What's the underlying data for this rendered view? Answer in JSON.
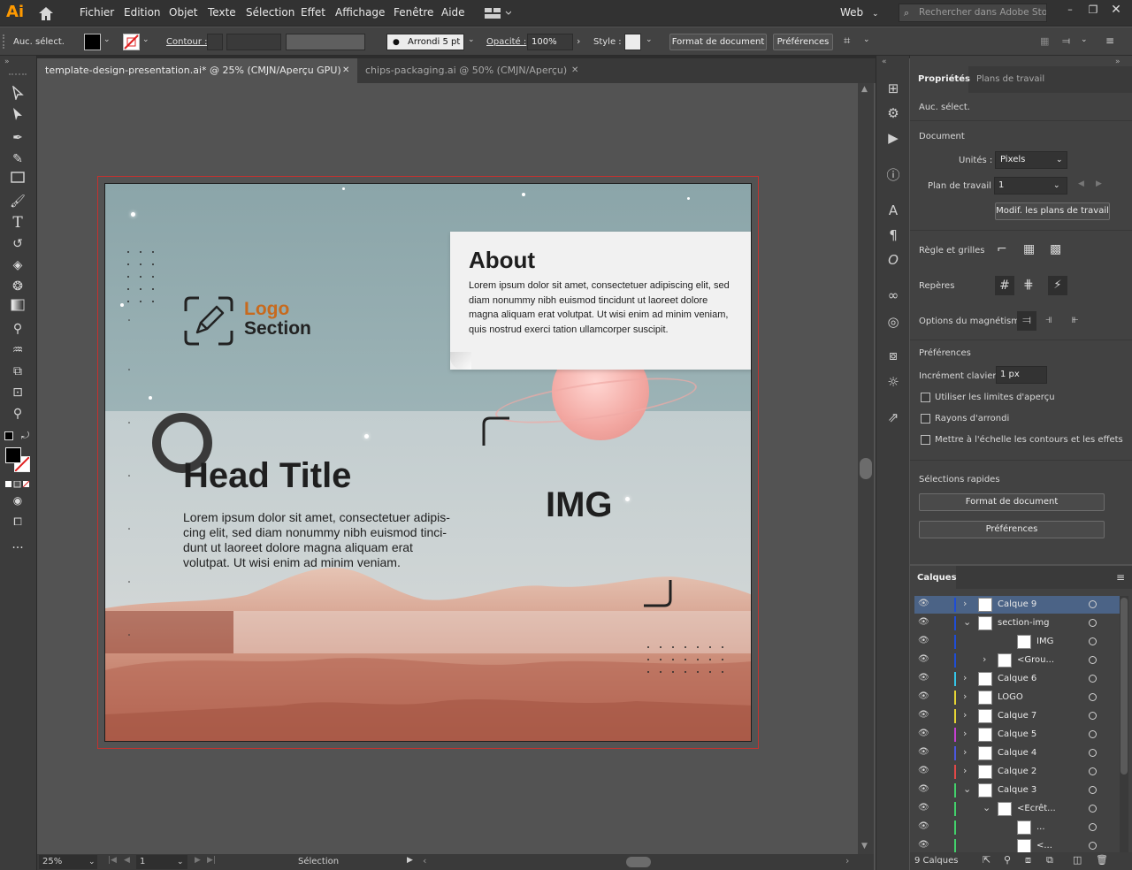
{
  "app": {
    "logo": "Ai",
    "menus": [
      "Fichier",
      "Edition",
      "Objet",
      "Texte",
      "Sélection",
      "Effet",
      "Affichage",
      "Fenêtre",
      "Aide"
    ],
    "workspace": "Web",
    "search_placeholder": "Rechercher dans Adobe Stock"
  },
  "control": {
    "selection": "Auc. sélect.",
    "stroke_label": "Contour :",
    "brush": "Arrondi 5 pt",
    "opacity_label": "Opacité :",
    "opacity": "100%",
    "style_label": "Style :",
    "doc_format": "Format de document",
    "prefs": "Préférences"
  },
  "tabs": [
    {
      "label": "template-design-presentation.ai* @ 25% (CMJN/Aperçu GPU)"
    },
    {
      "label": "chips-packaging.ai @ 50% (CMJN/Aperçu)"
    }
  ],
  "artboard": {
    "about_title": "About",
    "about_text": "Lorem ipsum dolor sit amet, consectetuer adipiscing elit, sed diam nonummy nibh euismod tincidunt ut laoreet dolore magna aliquam erat volutpat. Ut wisi enim ad minim veniam, quis nostrud exerci tation ullamcorper suscipit.",
    "logo_word": "Logo",
    "logo_section": "Section",
    "head_title": "Head Title",
    "head_text": "Lorem ipsum dolor sit amet, consectetuer adipis-cing elit, sed diam nonummy nibh euismod tinci-dunt ut laoreet dolore magna aliquam erat volutpat. Ut wisi enim ad minim veniam.",
    "img_label": "IMG",
    "colors": {
      "sky": "#8fa7ab",
      "mid": "#c6cfd1",
      "sand": "#c9836e",
      "about_box": "#f1f1f1",
      "logo_accent": "#c76a1e"
    }
  },
  "status": {
    "zoom": "25%",
    "artboard_num": "1",
    "tool": "Sélection"
  },
  "properties": {
    "tab_props": "Propriétés",
    "tab_boards": "Plans de travail",
    "no_selection": "Auc. sélect.",
    "document": "Document",
    "units_label": "Unités :",
    "units": "Pixels",
    "artboard_label": "Plan de travail :",
    "artboard_value": "1",
    "edit_boards": "Modif. les plans de travail",
    "rulers": "Règle et grilles",
    "guides": "Repères",
    "snap": "Options du magnétisme",
    "prefs_title": "Préférences",
    "keyboard_label": "Incrément clavier :",
    "keyboard_value": "1 px",
    "chk1": "Utiliser les limites d'aperçu",
    "chk2": "Rayons d'arrondi",
    "chk3": "Mettre à l'échelle les contours et les effets",
    "quick": "Sélections rapides",
    "qbtn1": "Format de document",
    "qbtn2": "Préférences"
  },
  "layers": {
    "title": "Calques",
    "count": "9 Calques",
    "rows": [
      {
        "name": "Calque 9",
        "color": "#1f4dd6",
        "indent": 0,
        "arrow": "›",
        "selected": true
      },
      {
        "name": "section-img",
        "color": "#1f4dd6",
        "indent": 0,
        "arrow": "⌄"
      },
      {
        "name": "IMG",
        "color": "#1f4dd6",
        "indent": 2,
        "arrow": ""
      },
      {
        "name": "<Grou...",
        "color": "#1f4dd6",
        "indent": 1,
        "arrow": "›"
      },
      {
        "name": "Calque 6",
        "color": "#35c6e8",
        "indent": 0,
        "arrow": "›"
      },
      {
        "name": "LOGO",
        "color": "#e6d534",
        "indent": 0,
        "arrow": "›"
      },
      {
        "name": "Calque 7",
        "color": "#e6d534",
        "indent": 0,
        "arrow": "›"
      },
      {
        "name": "Calque 5",
        "color": "#c63fd1",
        "indent": 0,
        "arrow": "›"
      },
      {
        "name": "Calque 4",
        "color": "#4b57e0",
        "indent": 0,
        "arrow": "›"
      },
      {
        "name": "Calque 2",
        "color": "#e24848",
        "indent": 0,
        "arrow": "›"
      },
      {
        "name": "Calque 3",
        "color": "#43d16b",
        "indent": 0,
        "arrow": "⌄"
      },
      {
        "name": "<Ecrêt...",
        "color": "#43d16b",
        "indent": 1,
        "arrow": "⌄"
      },
      {
        "name": "...",
        "color": "#43d16b",
        "indent": 2,
        "arrow": ""
      },
      {
        "name": "<...",
        "color": "#43d16b",
        "indent": 2,
        "arrow": ""
      }
    ]
  }
}
